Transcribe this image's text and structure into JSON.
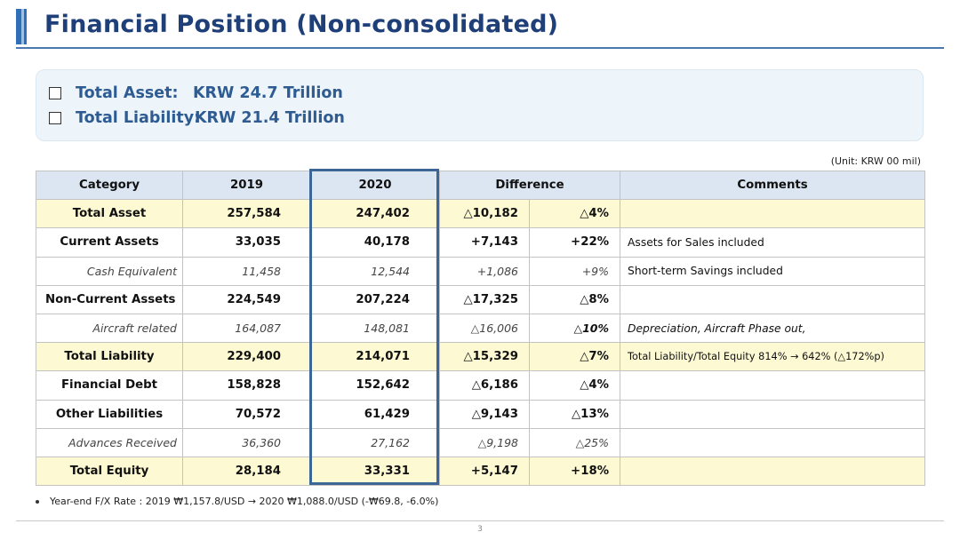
{
  "title": "Financial Position (Non-consolidated)",
  "summary": [
    {
      "label": "Total Asset:",
      "value": "KRW 24.7 Trillion"
    },
    {
      "label": "Total Liability:",
      "value": "KRW 21.4 Trillion"
    }
  ],
  "unit": "(Unit: KRW 00 mil)",
  "table": {
    "headers": {
      "category": "Category",
      "y2019": "2019",
      "y2020": "2020",
      "difference": "Difference",
      "comments": "Comments"
    },
    "rows": [
      {
        "category": "Total Asset",
        "y2019": "257,584",
        "y2020": "247,402",
        "diff": "△10,182",
        "pct": "△4%",
        "comment": ""
      },
      {
        "category": "Current Assets",
        "y2019": "33,035",
        "y2020": "40,178",
        "diff": "+7,143",
        "pct": "+22%",
        "comment": "Assets for Sales included"
      },
      {
        "category": "Cash Equivalent",
        "y2019": "11,458",
        "y2020": "12,544",
        "diff": "+1,086",
        "pct": "+9%",
        "comment": "Short-term Savings included"
      },
      {
        "category": "Non-Current Assets",
        "y2019": "224,549",
        "y2020": "207,224",
        "diff": "△17,325",
        "pct": "△8%",
        "comment": ""
      },
      {
        "category": "Aircraft related",
        "y2019": "164,087",
        "y2020": "148,081",
        "diff": "△16,006",
        "pct": "△10%",
        "comment": "Depreciation, Aircraft Phase out,"
      },
      {
        "category": "Total Liability",
        "y2019": "229,400",
        "y2020": "214,071",
        "diff": "△15,329",
        "pct": "△7%",
        "comment": "Total Liability/Total Equity 814% → 642% (△172%p)"
      },
      {
        "category": "Financial Debt",
        "y2019": "158,828",
        "y2020": "152,642",
        "diff": "△6,186",
        "pct": "△4%",
        "comment": ""
      },
      {
        "category": "Other Liabilities",
        "y2019": "70,572",
        "y2020": "61,429",
        "diff": "△9,143",
        "pct": "△13%",
        "comment": ""
      },
      {
        "category": "Advances Received",
        "y2019": "36,360",
        "y2020": "27,162",
        "diff": "△9,198",
        "pct": "△25%",
        "comment": ""
      },
      {
        "category": "Total Equity",
        "y2019": "28,184",
        "y2020": "33,331",
        "diff": "+5,147",
        "pct": "+18%",
        "comment": ""
      }
    ]
  },
  "footnote": "Year-end F/X Rate : 2019 ₩1,157.8/USD → 2020 ₩1,088.0/USD (-₩69.8, -6.0%)",
  "page_number": "3",
  "colors": {
    "title": "#1f3f78",
    "accent": "#2f6fb8",
    "summary_text": "#2e5b92",
    "header_bg": "#dbe6f2",
    "highlight_row": "#fdf9d3",
    "column_highlight_border": "#3c6696"
  }
}
